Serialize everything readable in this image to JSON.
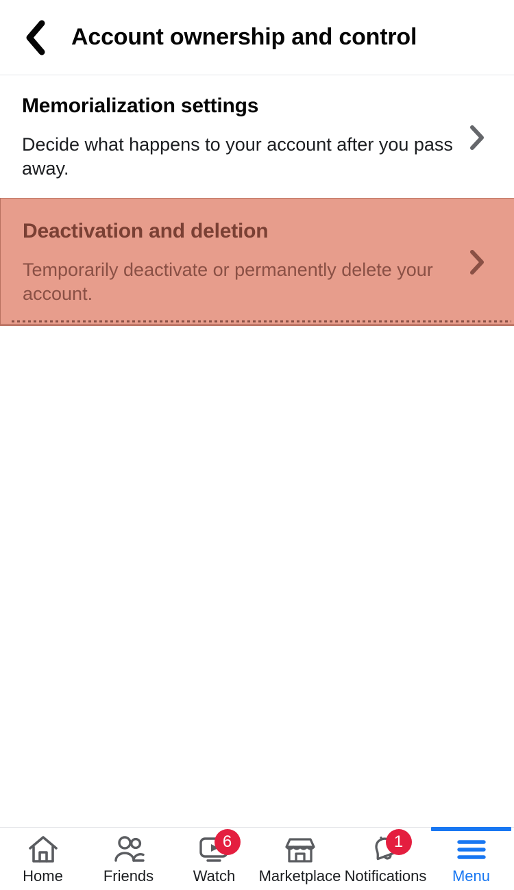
{
  "header": {
    "back_icon": "chevron-left-icon",
    "title": "Account ownership and control"
  },
  "settings": {
    "rows": [
      {
        "title": "Memorialization settings",
        "description": "Decide what happens to your account after you pass away.",
        "chevron": "chevron-right-icon",
        "highlighted": false
      },
      {
        "title": "Deactivation and deletion",
        "description": "Temporarily deactivate or permanently delete your account.",
        "chevron": "chevron-right-icon",
        "highlighted": true
      }
    ]
  },
  "highlight": {
    "background_color": "#E79D8C",
    "border_color": "#B8705F",
    "title_color": "#7A4034",
    "description_color": "#8A5045"
  },
  "bottom_nav": {
    "active_item": "Menu",
    "accent_color": "#1877F2",
    "badge_color": "#E41E3F",
    "items": [
      {
        "label": "Home",
        "icon": "home-icon",
        "badge": "",
        "active": false
      },
      {
        "label": "Friends",
        "icon": "friends-icon",
        "badge": "",
        "active": false
      },
      {
        "label": "Watch",
        "icon": "watch-icon",
        "badge": "6",
        "active": false
      },
      {
        "label": "Marketplace",
        "icon": "marketplace-icon",
        "badge": "",
        "active": false
      },
      {
        "label": "Notifications",
        "icon": "bell-icon",
        "badge": "1",
        "active": false
      },
      {
        "label": "Menu",
        "icon": "hamburger-menu-icon",
        "badge": "",
        "active": true
      }
    ]
  }
}
